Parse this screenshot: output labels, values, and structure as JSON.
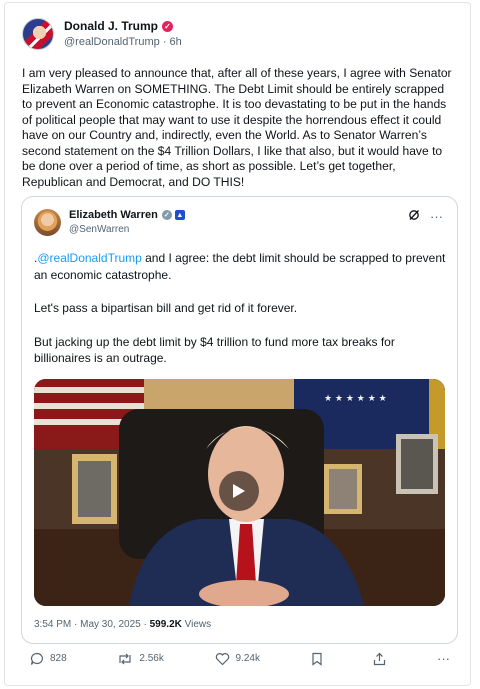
{
  "author": {
    "name": "Donald J. Trump",
    "handle": "@realDonaldTrump",
    "time": "6h",
    "separator": "·"
  },
  "post_text": "I am very pleased to announce that, after all of these years, I agree with Senator Elizabeth Warren on SOMETHING. The Debt Limit should be entirely scrapped to prevent an Economic catastrophe. It is too devastating to be put in the hands of political people that may want to use it despite the horrendous effect it could have on our Country and, indirectly, even the World. As to Senator Warren’s second statement on the $4 Trillion Dollars, I like that also, but it would have to be done over a period of time, as short as possible. Let’s get together, Republican and Democrat, and DO THIS!",
  "quote": {
    "name": "Elizabeth Warren",
    "handle": "@SenWarren",
    "mention_prefix": ".",
    "mention": "@realDonaldTrump",
    "para1_rest": " and I agree: the debt limit should be scrapped to prevent an economic catastrophe.",
    "para2": "Let's pass a bipartisan bill and get rid of it forever.",
    "para3": "But jacking up the debt limit by $4 trillion to fund more tax breaks for billionaires is an outrage.",
    "timestamp": "3:54 PM · May 30, 2025 · ",
    "views_count": "599.2K",
    "views_label": " Views",
    "more_label": "···"
  },
  "actions": {
    "replies": "828",
    "reposts": "2.56k",
    "likes": "9.24k",
    "more": "···"
  },
  "colors": {
    "link": "#1d9bf0",
    "verified_badge": "#e0245e",
    "muted_text": "#536471"
  },
  "icons": [
    "verified-badge-icon",
    "grey-check-icon",
    "flag-badge-icon",
    "grok-icon",
    "more-icon",
    "play-icon",
    "reply-icon",
    "repost-icon",
    "like-icon",
    "bookmark-icon",
    "share-icon"
  ]
}
